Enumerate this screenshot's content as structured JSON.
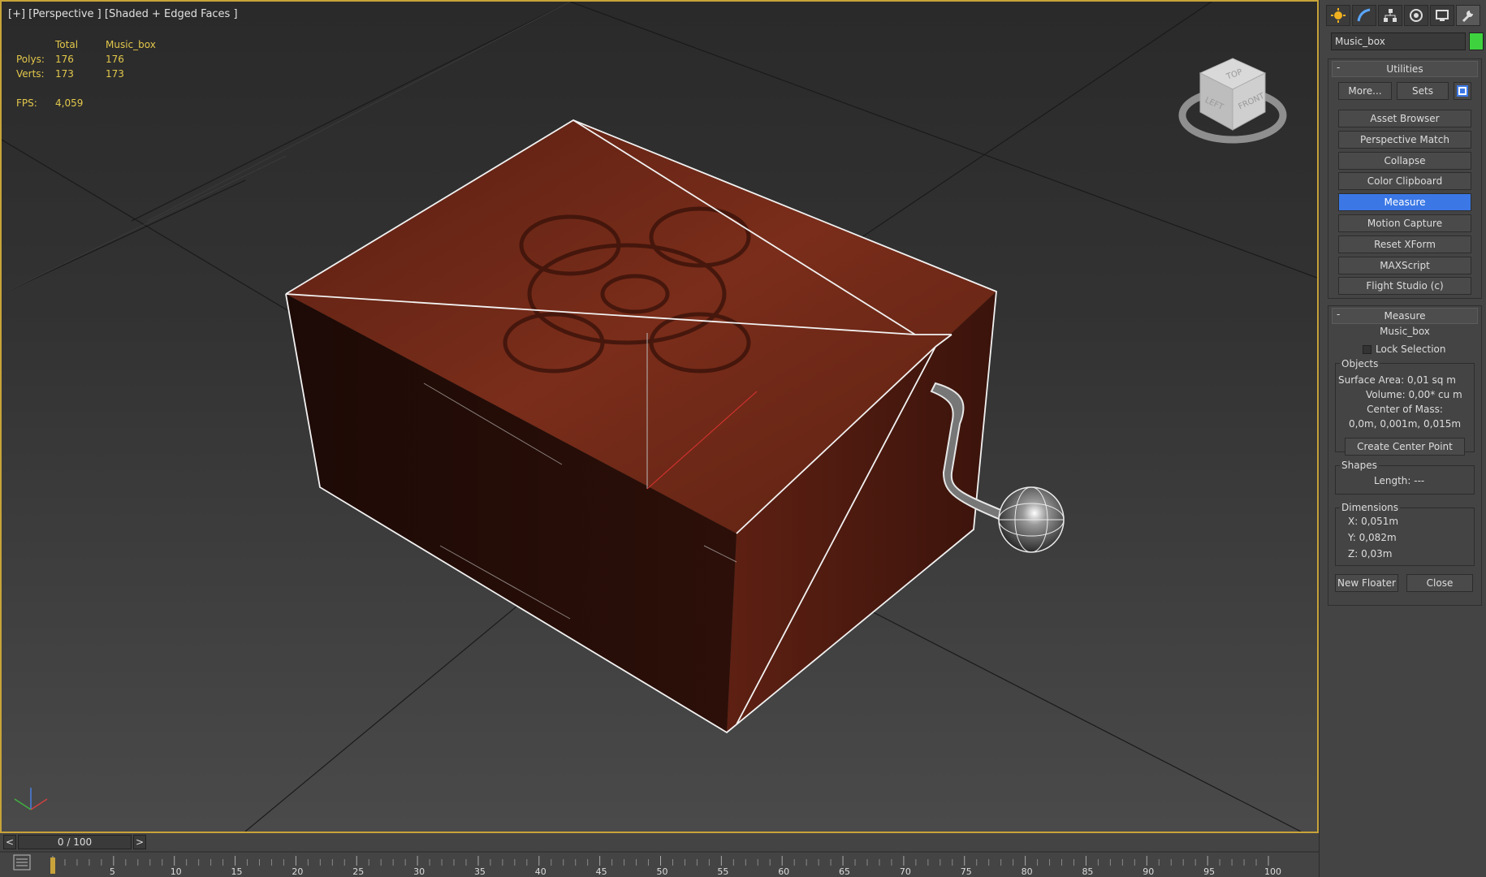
{
  "viewport": {
    "label": "[+] [Perspective ] [Shaded + Edged Faces ]",
    "stats": {
      "header_total": "Total",
      "header_object": "Music_box",
      "polys_label": "Polys:",
      "polys_total": "176",
      "polys_object": "176",
      "verts_label": "Verts:",
      "verts_total": "173",
      "verts_object": "173",
      "fps_label": "FPS:",
      "fps_value": "4,059"
    },
    "navcube_faces": {
      "top": "TOP",
      "left": "LEFT",
      "front": "FRONT"
    },
    "accent_color": "#c8a33a"
  },
  "command_panel": {
    "tabs": [
      {
        "icon": "create-icon"
      },
      {
        "icon": "modify-icon"
      },
      {
        "icon": "hierarchy-icon"
      },
      {
        "icon": "motion-icon"
      },
      {
        "icon": "display-icon"
      },
      {
        "icon": "utilities-icon",
        "active": true
      }
    ],
    "object_name": "Music_box",
    "object_color": "#3ed33e",
    "utilities": {
      "title": "Utilities",
      "more_label": "More...",
      "sets_label": "Sets",
      "items": [
        "Asset Browser",
        "Perspective Match",
        "Collapse",
        "Color Clipboard",
        "Measure",
        "Motion Capture",
        "Reset XForm",
        "MAXScript",
        "Flight Studio (c)"
      ],
      "active_item": "Measure"
    },
    "measure": {
      "title": "Measure",
      "object": "Music_box",
      "lock_selection": "Lock Selection",
      "objects_group": "Objects",
      "surface_area": "Surface Area:  0,01 sq m",
      "volume": "Volume:  0,00* cu m",
      "center_of_mass_label": "Center of Mass:",
      "center_of_mass_value": "0,0m, 0,001m, 0,015m",
      "create_center_point": "Create Center Point",
      "shapes_group": "Shapes",
      "length": "Length:  ---",
      "dimensions_group": "Dimensions",
      "dim_x": "X:   0,051m",
      "dim_y": "Y:   0,082m",
      "dim_z": "Z:   0,03m",
      "new_floater": "New Floater",
      "close": "Close"
    },
    "accent_active": "#3b78e6"
  },
  "timeline": {
    "frame_display": "0 / 100",
    "prev": "<",
    "next": ">",
    "ticks": [
      "5",
      "10",
      "15",
      "20",
      "25",
      "30",
      "35",
      "40",
      "45",
      "50",
      "55",
      "60",
      "65",
      "70",
      "75",
      "80",
      "85",
      "90",
      "95",
      "100"
    ]
  }
}
